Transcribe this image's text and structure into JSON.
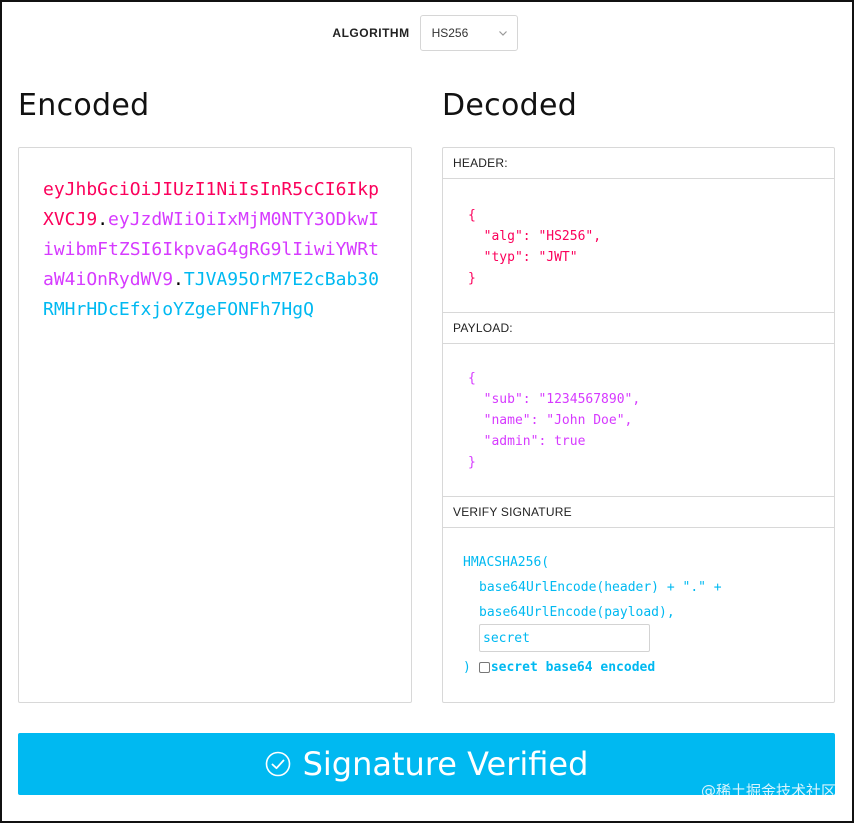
{
  "algorithm": {
    "label": "ALGORITHM",
    "selected": "HS256"
  },
  "encoded": {
    "title": "Encoded",
    "token_header": "eyJhbGciOiJIUzI1NiIsInR5cCI6IkpXVCJ9",
    "token_payload": "eyJzdWIiOiIxMjM0NTY3ODkwIiwibmFtZSI6IkpvaG4gRG9lIiwiYWRtaW4iOnRydWV9",
    "token_signature": "TJVA95OrM7E2cBab30RMHrHDcEfxjoYZgeFONFh7HgQ",
    "dot": "."
  },
  "decoded": {
    "title": "Decoded",
    "header_label": "HEADER:",
    "header_json": "{\n  \"alg\": \"HS256\",\n  \"typ\": \"JWT\"\n}",
    "payload_label": "PAYLOAD:",
    "payload_json": "{\n  \"sub\": \"1234567890\",\n  \"name\": \"John Doe\",\n  \"admin\": true\n}",
    "signature_label": "VERIFY SIGNATURE",
    "sig_line1": "HMACSHA256(",
    "sig_line2": "base64UrlEncode(header) + \".\" +",
    "sig_line3": "base64UrlEncode(payload),",
    "secret_value": "secret",
    "sig_close": ")",
    "base64_label": "secret base64 encoded"
  },
  "status": {
    "label": "Signature Verified"
  },
  "watermark": "@稀土掘金技术社区",
  "colors": {
    "header": "#fb015b",
    "payload": "#d63aff",
    "signature": "#00b9f1",
    "verified_bg": "#00b9f1"
  },
  "icons": {
    "select": "chevron-down-icon",
    "verified": "check-circle-icon"
  }
}
